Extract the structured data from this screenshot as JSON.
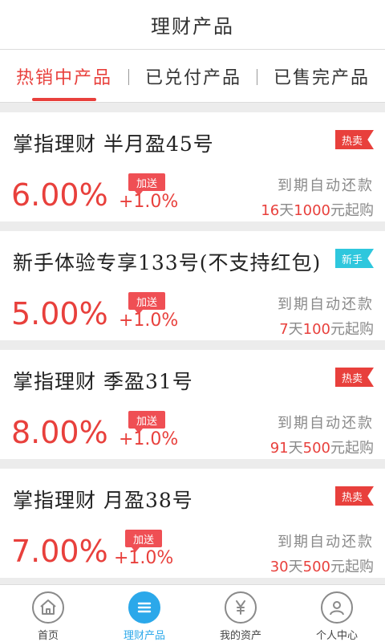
{
  "header": {
    "title": "理财产品"
  },
  "tabs": [
    {
      "label": "热销中产品",
      "active": true
    },
    {
      "label": "已兑付产品",
      "active": false
    },
    {
      "label": "已售完产品",
      "active": false
    }
  ],
  "products": [
    {
      "title": "掌指理财  半月盈45号",
      "tag": "热卖",
      "tag_type": "hot",
      "rate": "6.00%",
      "bonus_label": "加送",
      "bonus_rate": "+1.0%",
      "repay": "到期自动还款",
      "days": "16",
      "days_unit": "天",
      "min_amount": "1000",
      "min_suffix": "元起购"
    },
    {
      "title": "新手体验专享133号(不支持红包)",
      "tag": "新手",
      "tag_type": "new",
      "rate": "5.00%",
      "bonus_label": "加送",
      "bonus_rate": "+1.0%",
      "repay": "到期自动还款",
      "days": "7",
      "days_unit": "天",
      "min_amount": "100",
      "min_suffix": "元起购"
    },
    {
      "title": "掌指理财  季盈31号",
      "tag": "热卖",
      "tag_type": "hot",
      "rate": "8.00%",
      "bonus_label": "加送",
      "bonus_rate": "+1.0%",
      "repay": "到期自动还款",
      "days": "91",
      "days_unit": "天",
      "min_amount": "500",
      "min_suffix": "元起购"
    },
    {
      "title": "掌指理财  月盈38号",
      "tag": "热卖",
      "tag_type": "hot",
      "rate": "7.00%",
      "bonus_label": "加送",
      "bonus_rate": "+1.0%",
      "repay": "到期自动还款",
      "days": "30",
      "days_unit": "天",
      "min_amount": "500",
      "min_suffix": "元起购"
    }
  ],
  "bottom_nav": [
    {
      "label": "首页",
      "icon": "home-icon",
      "active": false
    },
    {
      "label": "理财产品",
      "icon": "list-icon",
      "active": true
    },
    {
      "label": "我的资产",
      "icon": "yen-icon",
      "active": false
    },
    {
      "label": "个人中心",
      "icon": "user-icon",
      "active": false
    }
  ],
  "colors": {
    "accent": "#e8403c",
    "new_tag": "#2ec7dd",
    "nav_active": "#2ba8ea",
    "muted_text": "#8a8a8a"
  }
}
